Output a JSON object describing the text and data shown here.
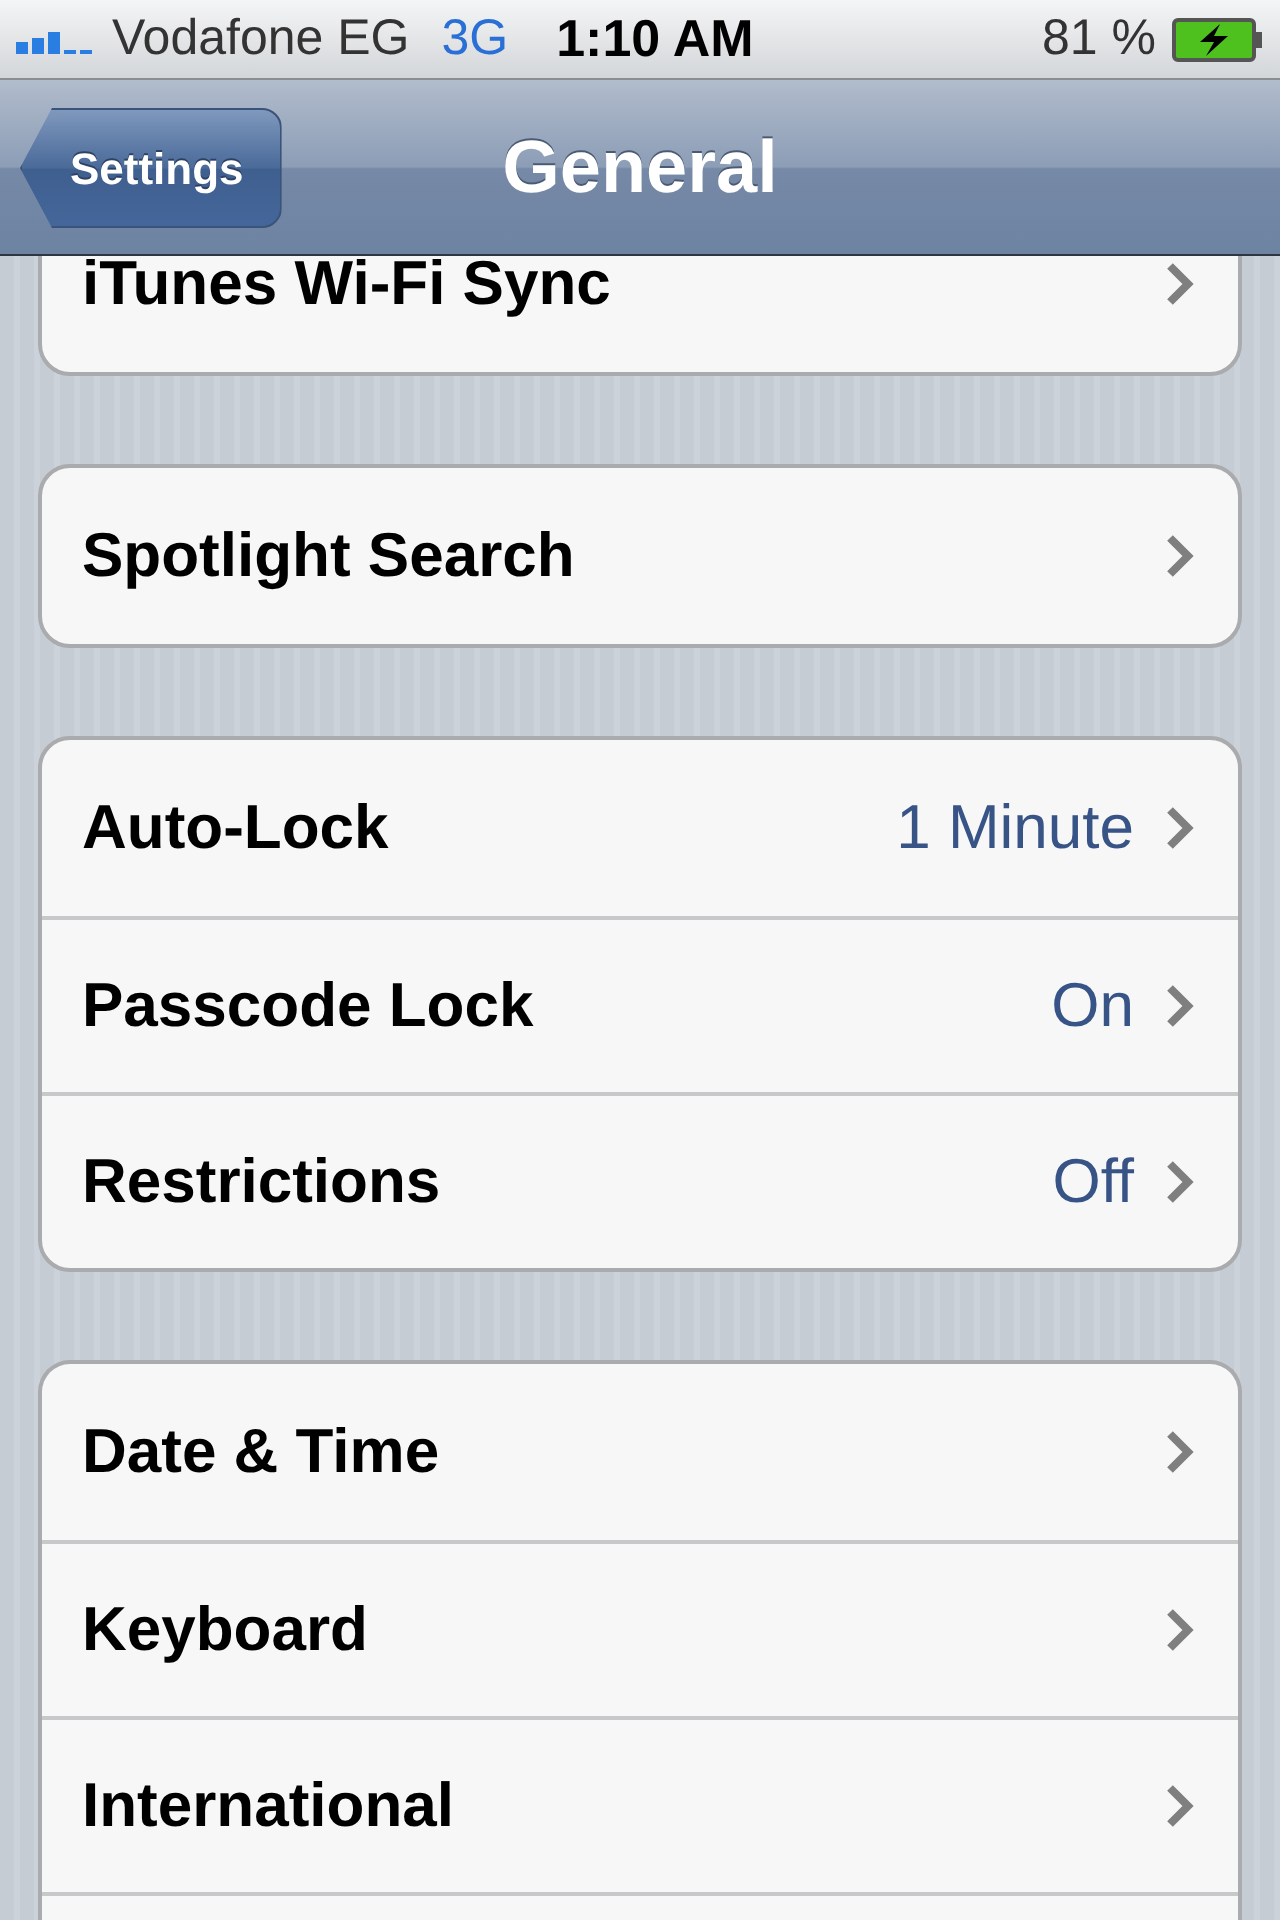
{
  "status_bar": {
    "carrier": "Vodafone EG",
    "network": "3G",
    "time": "1:10 AM",
    "battery": "81 %"
  },
  "nav_bar": {
    "back_button": "Settings",
    "title": "General"
  },
  "groups": [
    {
      "rows": [
        {
          "label": "iTunes Wi-Fi Sync"
        }
      ]
    },
    {
      "rows": [
        {
          "label": "Spotlight Search"
        }
      ]
    },
    {
      "rows": [
        {
          "label": "Auto-Lock",
          "value": "1 Minute"
        },
        {
          "label": "Passcode Lock",
          "value": "On"
        },
        {
          "label": "Restrictions",
          "value": "Off"
        }
      ]
    },
    {
      "rows": [
        {
          "label": "Date & Time"
        },
        {
          "label": "Keyboard"
        },
        {
          "label": "International"
        }
      ]
    }
  ]
}
